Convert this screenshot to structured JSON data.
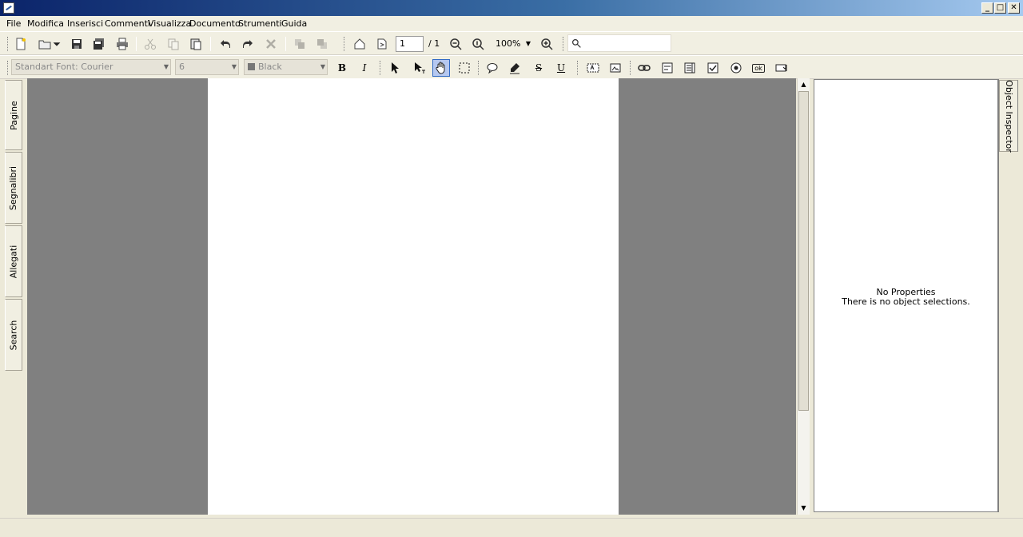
{
  "menu": {
    "items": [
      "File",
      "Modifica",
      "Inserisci",
      "Commenti",
      "Visualizza",
      "Documento",
      "Strumenti",
      "Guida"
    ]
  },
  "navigation": {
    "page_value": "1",
    "page_total": "/ 1",
    "zoom": "100%"
  },
  "format": {
    "font": "Standart Font: Courier",
    "size": "6",
    "color_name": "Black",
    "bold_label": "B",
    "italic_label": "I",
    "strike_label": "S",
    "underline_label": "U",
    "ok_label": "ok"
  },
  "left_tabs": [
    "Pagine",
    "Segnalibri",
    "Allegati",
    "Search"
  ],
  "inspector": {
    "tab_label": "Object Inspector",
    "title": "No Properties",
    "message": "There is no object selections."
  },
  "colors": {
    "title_gradient_start": "#0b246a",
    "canvas": "#808080",
    "active_tool": "#b6c8f0"
  }
}
